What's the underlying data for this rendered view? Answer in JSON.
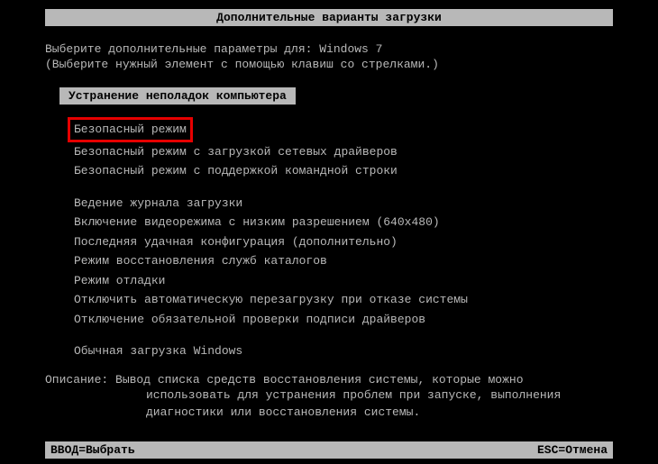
{
  "title": "Дополнительные варианты загрузки",
  "instruction1": "Выберите дополнительные параметры для: Windows 7",
  "instruction2": "(Выберите нужный элемент с помощью клавиш со стрелками.)",
  "repairOption": "Устранение неполадок компьютера",
  "menu": {
    "safeMode": "Безопасный режим",
    "safeModeNetwork": "Безопасный режим с загрузкой сетевых драйверов",
    "safeModeCmd": "Безопасный режим с поддержкой командной строки",
    "bootLogging": "Ведение журнала загрузки",
    "lowRes": "Включение видеорежима с низким разрешением (640x480)",
    "lastKnownGood": "Последняя удачная конфигурация (дополнительно)",
    "dsRestore": "Режим восстановления служб каталогов",
    "debugMode": "Режим отладки",
    "disableAutoRestart": "Отключить автоматическую перезагрузку при отказе системы",
    "disableDriverSig": "Отключение обязательной проверки подписи драйверов",
    "normalStart": "Обычная загрузка Windows"
  },
  "description": {
    "label": "Описание: ",
    "line1": "Вывод списка средств восстановления системы, которые можно",
    "line2": "использовать для устранения проблем при запуске, выполнения",
    "line3": "диагностики или восстановления системы."
  },
  "footer": {
    "enter": "ВВОД=Выбрать",
    "esc": "ESC=Отмена"
  }
}
